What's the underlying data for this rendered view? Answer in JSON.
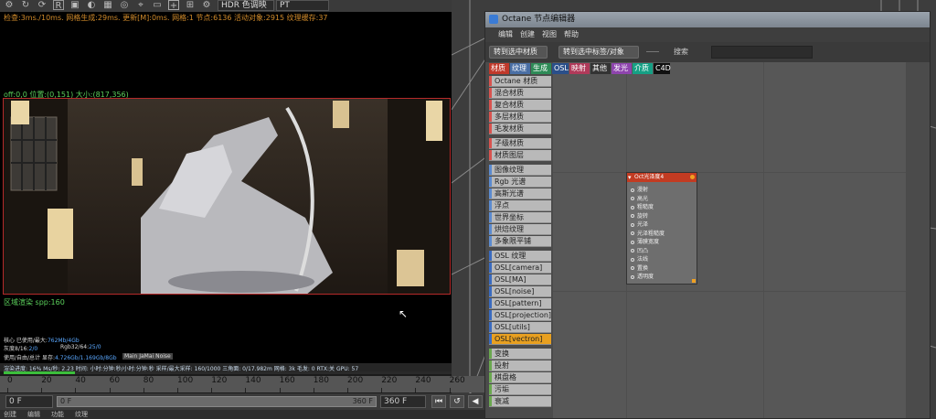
{
  "viewport": {
    "renderer_select": "HDR 色调映",
    "kernel_select": "PT",
    "stats_line": "检查:3ms./10ms. 网格生成:29ms. 更新[M]:0ms. 网格:1 节点:6136 活动对象:2915 纹理缓存:37",
    "offline_line": "off:0,0 位置:(0,151) 大小:(817,356)",
    "spp_line": "区域渲染 spp:160",
    "core_label": "核心 已使用/最大:",
    "core_value": "762Mb/4Gb",
    "gray_label": "灰度8/16:",
    "gray_value": "2/0",
    "rgb_label": "Rgb32/64:",
    "rgb_value": "25/0",
    "mem_label": "使用/自由/总计 显存:",
    "mem_value": "4.726Gb/1.169Gb/8Gb",
    "plugin_tag": "Main JaMai Noise",
    "status_bar": "渲染进度: 16%  Ms/秒: 2.23  时间: 小时:分钟:秒/小时:分钟:秒  采样/最大采样: 160/1000  三角面: 0/17.982m  网格: 3k  毛发: 0  RTX:关  GPU: 57",
    "progress_pct": 16
  },
  "timeline": {
    "ticks": [
      "0",
      "20",
      "40",
      "60",
      "80",
      "100",
      "120",
      "140",
      "160",
      "180",
      "200",
      "220",
      "240",
      "260"
    ],
    "start_frame": "0 F",
    "current_frame": "0 F",
    "end_frame": "360 F",
    "max_frame": "360 F",
    "bottom_labels": [
      "创建",
      "编辑",
      "功能",
      "纹理"
    ]
  },
  "node_editor": {
    "title": "Octane 节点编辑器",
    "menu": [
      "编辑",
      "创建",
      "视图",
      "帮助"
    ],
    "btn_to_material": "转到选中材质",
    "btn_to_tag": "转到选中标签/对象",
    "search_label": "搜索",
    "tabs": [
      {
        "label": "材质",
        "color": "#c0392b"
      },
      {
        "label": "纹理",
        "color": "#4a6fa5"
      },
      {
        "label": "生成",
        "color": "#2e8b57"
      },
      {
        "label": "OSL",
        "color": "#2a4f8a"
      },
      {
        "label": "映射",
        "color": "#b03a5a"
      },
      {
        "label": "其他",
        "color": "#333333"
      },
      {
        "label": "发光",
        "color": "#8e44ad"
      },
      {
        "label": "介质",
        "color": "#16a085"
      },
      {
        "label": "C4D",
        "color": "#111111"
      }
    ],
    "list_items": [
      {
        "label": "Octane 材质",
        "color": "#d9534f"
      },
      {
        "label": "混合材质",
        "color": "#d9534f"
      },
      {
        "label": "复合材质",
        "color": "#d9534f"
      },
      {
        "label": "多层材质",
        "color": "#d9534f"
      },
      {
        "label": "毛发材质",
        "color": "#d9534f"
      },
      {
        "label": "子级材质",
        "color": "#d9534f"
      },
      {
        "label": "材质图层",
        "color": "#d9534f"
      },
      {
        "label": "图像纹理",
        "color": "#5b8bd0"
      },
      {
        "label": "Rgb 光谱",
        "color": "#5b8bd0"
      },
      {
        "label": "高斯光谱",
        "color": "#5b8bd0"
      },
      {
        "label": "浮点",
        "color": "#5b8bd0"
      },
      {
        "label": "世界坐标",
        "color": "#5b8bd0"
      },
      {
        "label": "烘焙纹理",
        "color": "#5b8bd0"
      },
      {
        "label": "多象限平铺",
        "color": "#5b8bd0"
      },
      {
        "label": "OSL 纹理",
        "color": "#3a6bc0"
      },
      {
        "label": "OSL[camera]",
        "color": "#3a6bc0"
      },
      {
        "label": "OSL[MA]",
        "color": "#3a6bc0"
      },
      {
        "label": "OSL[noise]",
        "color": "#3a6bc0"
      },
      {
        "label": "OSL[pattern]",
        "color": "#3a6bc0"
      },
      {
        "label": "OSL[projection]",
        "color": "#3a6bc0"
      },
      {
        "label": "OSL[utils]",
        "color": "#3a6bc0"
      },
      {
        "label": "OSL[vectron]",
        "color": "#3a6bc0"
      },
      {
        "label": "变换",
        "color": "#6aa84f"
      },
      {
        "label": "投射",
        "color": "#6aa84f"
      },
      {
        "label": "棋盘格",
        "color": "#6aa84f"
      },
      {
        "label": "污垢",
        "color": "#6aa84f"
      },
      {
        "label": "衰减",
        "color": "#6aa84f"
      }
    ],
    "node": {
      "title": "Oct光泽度4",
      "pins": [
        "漫射",
        "高光",
        "粗糙度",
        "旋转",
        "光泽",
        "光泽粗糙度",
        "薄膜宽度",
        "凹凸",
        "法线",
        "置换",
        "透明度"
      ]
    }
  },
  "colors": {
    "accent_red": "#c23b22",
    "selected_item": "#e8a020",
    "progress_green": "#3cbf3c"
  }
}
